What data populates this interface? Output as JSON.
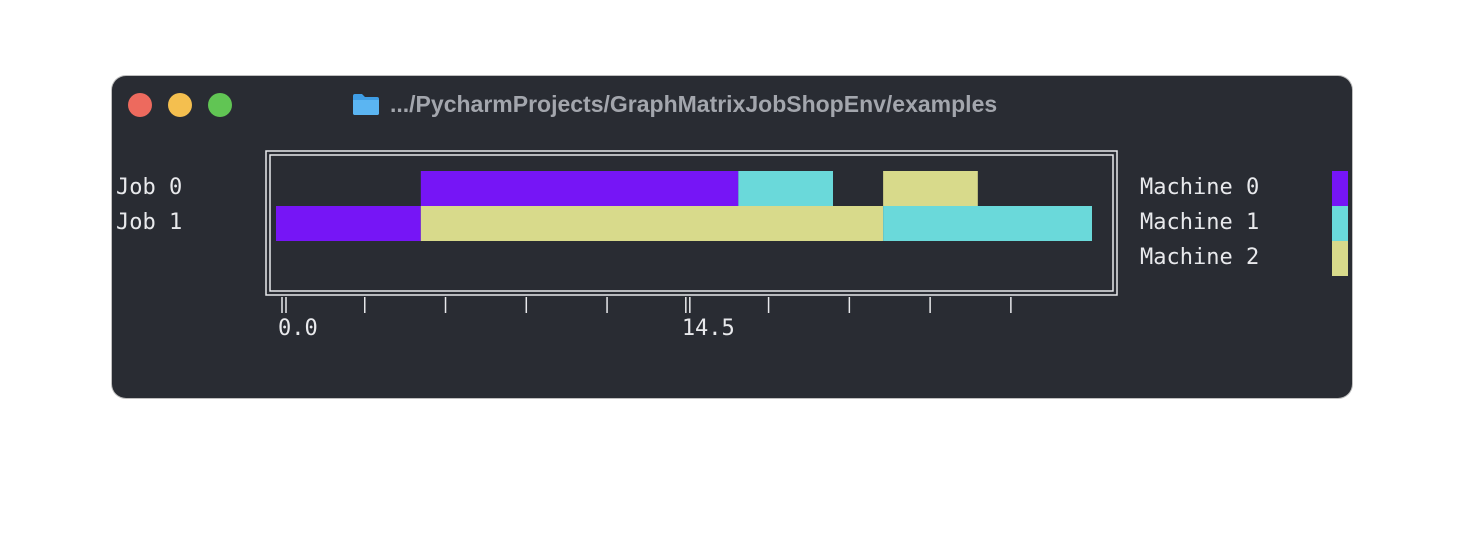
{
  "window": {
    "title": ".../PycharmProjects/GraphMatrixJobShopEnv/examples",
    "icon": "folder-icon"
  },
  "colors": {
    "background": "#292c33",
    "frame": "#e8e9ec",
    "machine_0": "#7615f6",
    "machine_1": "#6ad9da",
    "machine_2": "#d8da8b"
  },
  "chart_data": {
    "type": "gantt",
    "jobs": [
      "Job 0",
      "Job 1"
    ],
    "machines": [
      "Machine 0",
      "Machine 1",
      "Machine 2"
    ],
    "x_tick_labels": [
      "0.0",
      "14.5"
    ],
    "x_labeled_ticks": [
      0.0,
      14.5
    ],
    "x_minor_tick_step": 2.9,
    "x_tick_count": 10,
    "xlim": [
      0.0,
      29.3
    ],
    "tasks": [
      {
        "job": "Job 0",
        "machine": "Machine 0",
        "start": 5.2,
        "end": 16.6
      },
      {
        "job": "Job 0",
        "machine": "Machine 1",
        "start": 16.6,
        "end": 20.0
      },
      {
        "job": "Job 0",
        "machine": "Machine 2",
        "start": 21.8,
        "end": 25.2
      },
      {
        "job": "Job 1",
        "machine": "Machine 0",
        "start": 0.0,
        "end": 5.2
      },
      {
        "job": "Job 1",
        "machine": "Machine 2",
        "start": 5.2,
        "end": 21.8
      },
      {
        "job": "Job 1",
        "machine": "Machine 1",
        "start": 21.8,
        "end": 29.3
      }
    ]
  }
}
